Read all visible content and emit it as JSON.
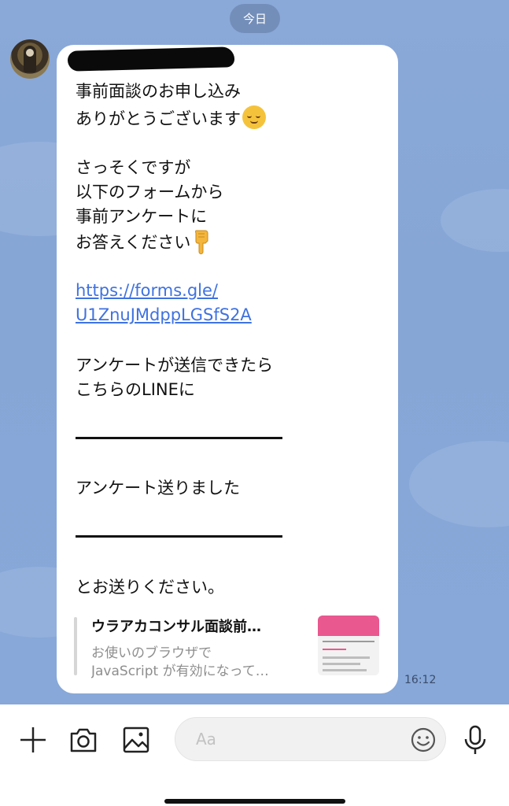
{
  "header": {
    "date_label": "今日"
  },
  "message": {
    "sender_name": "",
    "lines_block1": [
      "事前面談のお申し込み",
      "ありがとうございます"
    ],
    "lines_block2": [
      "さっそくですが",
      "以下のフォームから",
      "事前アンケートに",
      "お答えください"
    ],
    "link_lines": [
      "https://forms.gle/",
      "U1ZnuJMdppLGSfS2A"
    ],
    "lines_block3": [
      "アンケートが送信できたら",
      "こちらのLINEに"
    ],
    "quote_line": "アンケート送りました",
    "closing_line": "とお送りください。",
    "time": "16:12",
    "emoji_1": "relieved-face",
    "emoji_2": "backhand-index-pointing-down"
  },
  "link_preview": {
    "title": "ウラアカコンサル面談前…",
    "desc_line1": "お使いのブラウザで",
    "desc_line2": "JavaScript が有効になって…",
    "thumb_colors": {
      "accent": "#e9588f"
    }
  },
  "toolbar": {
    "input_placeholder": "Aa",
    "icons": [
      "plus-icon",
      "camera-icon",
      "image-icon",
      "emoji-icon",
      "microphone-icon"
    ]
  },
  "colors": {
    "chat_background": "#89a8d7",
    "bubble": "#ffffff",
    "link": "#3f72e0"
  }
}
